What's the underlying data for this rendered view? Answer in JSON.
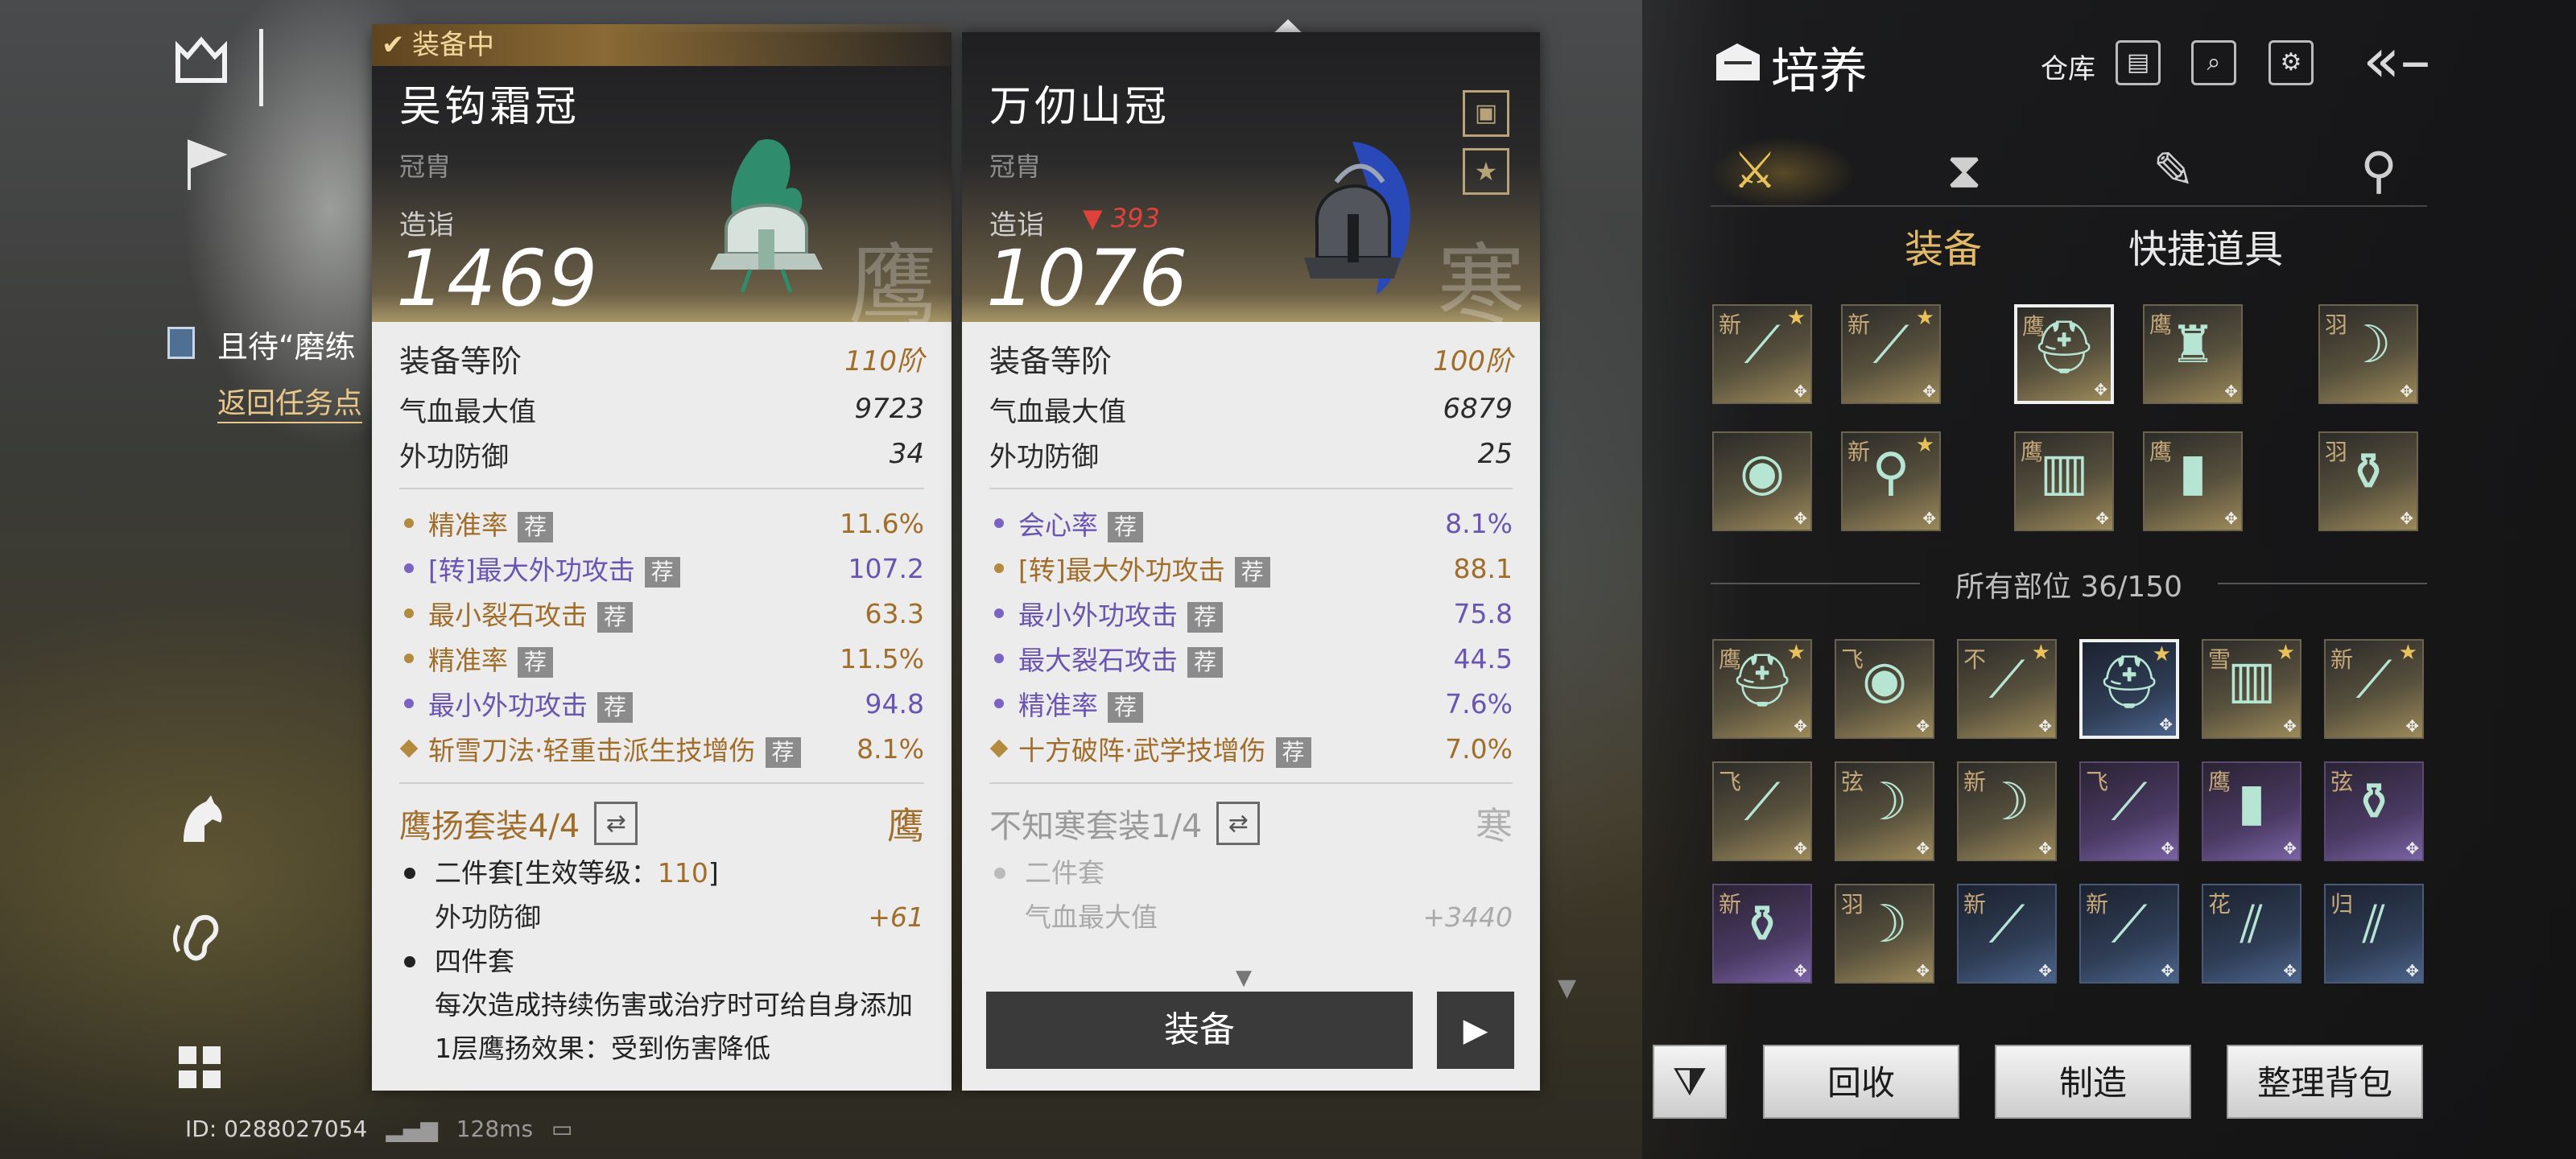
{
  "left_hud": {
    "quest_title": "且待“磨练",
    "quest_link": "返回任务点",
    "id_text": "ID: 0288027054",
    "ping": "128ms"
  },
  "compare_card": {
    "status_tag": "装备中",
    "name": "吴钩霜冠",
    "type": "冠胄",
    "score_label": "造诣",
    "score": "1469",
    "seal": "鹰",
    "tier_label": "装备等阶",
    "tier_value": "110阶",
    "base_stats": [
      {
        "label": "气血最大值",
        "value": "9723"
      },
      {
        "label": "外功防御",
        "value": "34"
      }
    ],
    "sub_stats": [
      {
        "label": "精准率",
        "tag": "荐",
        "value": "11.6%",
        "color": "gold",
        "marker": "dot"
      },
      {
        "label": "[转]最大外功攻击",
        "tag": "荐",
        "value": "107.2",
        "color": "purple",
        "marker": "dot"
      },
      {
        "label": "最小裂石攻击",
        "tag": "荐",
        "value": "63.3",
        "color": "gold",
        "marker": "dot"
      },
      {
        "label": "精准率",
        "tag": "荐",
        "value": "11.5%",
        "color": "gold",
        "marker": "dot"
      },
      {
        "label": "最小外功攻击",
        "tag": "荐",
        "value": "94.8",
        "color": "purple",
        "marker": "dot"
      },
      {
        "label": "斩雪刀法·轻重击派生技增伤",
        "tag": "荐",
        "value": "8.1%",
        "color": "gold",
        "marker": "diamond"
      }
    ],
    "set_name": "鹰扬套装4/4",
    "set_seal": "鹰",
    "set_bonus": [
      {
        "title": "二件套[生效等级：",
        "level": "110",
        "title_end": "]",
        "stat": "外功防御",
        "stat_value": "+61"
      },
      {
        "title": "四件套",
        "desc": "每次造成持续伤害或治疗时可给自身添加1层鹰扬效果：受到伤害降低"
      }
    ]
  },
  "new_card": {
    "name": "万仞山冠",
    "type": "冠胄",
    "score_label": "造诣",
    "score_diff": "▼ 393",
    "score": "1076",
    "seal": "寒",
    "tier_label": "装备等阶",
    "tier_value": "100阶",
    "base_stats": [
      {
        "label": "气血最大值",
        "value": "6879"
      },
      {
        "label": "外功防御",
        "value": "25"
      }
    ],
    "sub_stats": [
      {
        "label": "会心率",
        "tag": "荐",
        "value": "8.1%",
        "color": "purple",
        "marker": "dot"
      },
      {
        "label": "[转]最大外功攻击",
        "tag": "荐",
        "value": "88.1",
        "color": "gold",
        "marker": "dot"
      },
      {
        "label": "最小外功攻击",
        "tag": "荐",
        "value": "75.8",
        "color": "purple",
        "marker": "dot"
      },
      {
        "label": "最大裂石攻击",
        "tag": "荐",
        "value": "44.5",
        "color": "purple",
        "marker": "dot"
      },
      {
        "label": "精准率",
        "tag": "荐",
        "value": "7.6%",
        "color": "purple",
        "marker": "dot"
      },
      {
        "label": "十方破阵·武学技增伤",
        "tag": "荐",
        "value": "7.0%",
        "color": "gold",
        "marker": "diamond"
      }
    ],
    "set_name": "不知寒套装1/4",
    "set_seal": "寒",
    "set_bonus": [
      {
        "title": "二件套",
        "stat": "气血最大值",
        "stat_value": "+3440"
      }
    ],
    "equip_button": "装备"
  },
  "right_panel": {
    "title": "培养",
    "warehouse": "仓库",
    "subtabs": [
      "装备",
      "快捷道具"
    ],
    "active_subtab": "装备",
    "all_parts_label": "所有部位",
    "all_parts_count": "36/150",
    "equipped_slots": [
      {
        "char": "新",
        "star": true,
        "icon": "sword"
      },
      {
        "char": "新",
        "star": true,
        "icon": "spear"
      },
      {
        "char": "鹰",
        "star": false,
        "icon": "helmet",
        "selected": true
      },
      {
        "char": "鹰",
        "star": false,
        "icon": "armor"
      },
      {
        "char": "羽",
        "star": false,
        "icon": "bow"
      },
      {
        "char": "",
        "star": false,
        "icon": "jade"
      },
      {
        "char": "新",
        "star": true,
        "icon": "pendant"
      },
      {
        "char": "鹰",
        "star": false,
        "icon": "gauntlet"
      },
      {
        "char": "鹰",
        "star": false,
        "icon": "boots"
      },
      {
        "char": "羽",
        "star": false,
        "icon": "vase"
      }
    ],
    "inventory": [
      {
        "char": "鹰",
        "star": true,
        "icon": "helmet",
        "tone": "gold"
      },
      {
        "char": "飞",
        "star": false,
        "icon": "jade",
        "tone": "gold"
      },
      {
        "char": "不",
        "star": true,
        "icon": "spear",
        "tone": "gold"
      },
      {
        "char": "",
        "star": true,
        "icon": "helmet",
        "tone": "blue",
        "selected": true
      },
      {
        "char": "雪",
        "star": true,
        "icon": "gauntlet",
        "tone": "gold"
      },
      {
        "char": "新",
        "star": true,
        "icon": "spear",
        "tone": "gold"
      },
      {
        "char": "飞",
        "star": false,
        "icon": "spear",
        "tone": "gold"
      },
      {
        "char": "弦",
        "star": false,
        "icon": "bow",
        "tone": "gold"
      },
      {
        "char": "新",
        "star": false,
        "icon": "bow",
        "tone": "gold"
      },
      {
        "char": "飞",
        "star": false,
        "icon": "spear",
        "tone": "purp"
      },
      {
        "char": "鹰",
        "star": false,
        "icon": "boots",
        "tone": "purp"
      },
      {
        "char": "弦",
        "star": false,
        "icon": "vase",
        "tone": "purp"
      },
      {
        "char": "新",
        "star": false,
        "icon": "vase",
        "tone": "purp"
      },
      {
        "char": "羽",
        "star": false,
        "icon": "bow",
        "tone": "gold"
      },
      {
        "char": "新",
        "star": false,
        "icon": "sword",
        "tone": "blue"
      },
      {
        "char": "新",
        "star": false,
        "icon": "sword",
        "tone": "blue"
      },
      {
        "char": "花",
        "star": false,
        "icon": "dual",
        "tone": "blue"
      },
      {
        "char": "归",
        "star": false,
        "icon": "dual",
        "tone": "blue"
      }
    ],
    "buttons": {
      "recycle": "回收",
      "craft": "制造",
      "sort": "整理背包"
    }
  },
  "colors": {
    "gold_text": "#a06e2a",
    "purple_text": "#6a56b0",
    "down_red": "#e0423b",
    "seal_gold": "#c79a55"
  }
}
